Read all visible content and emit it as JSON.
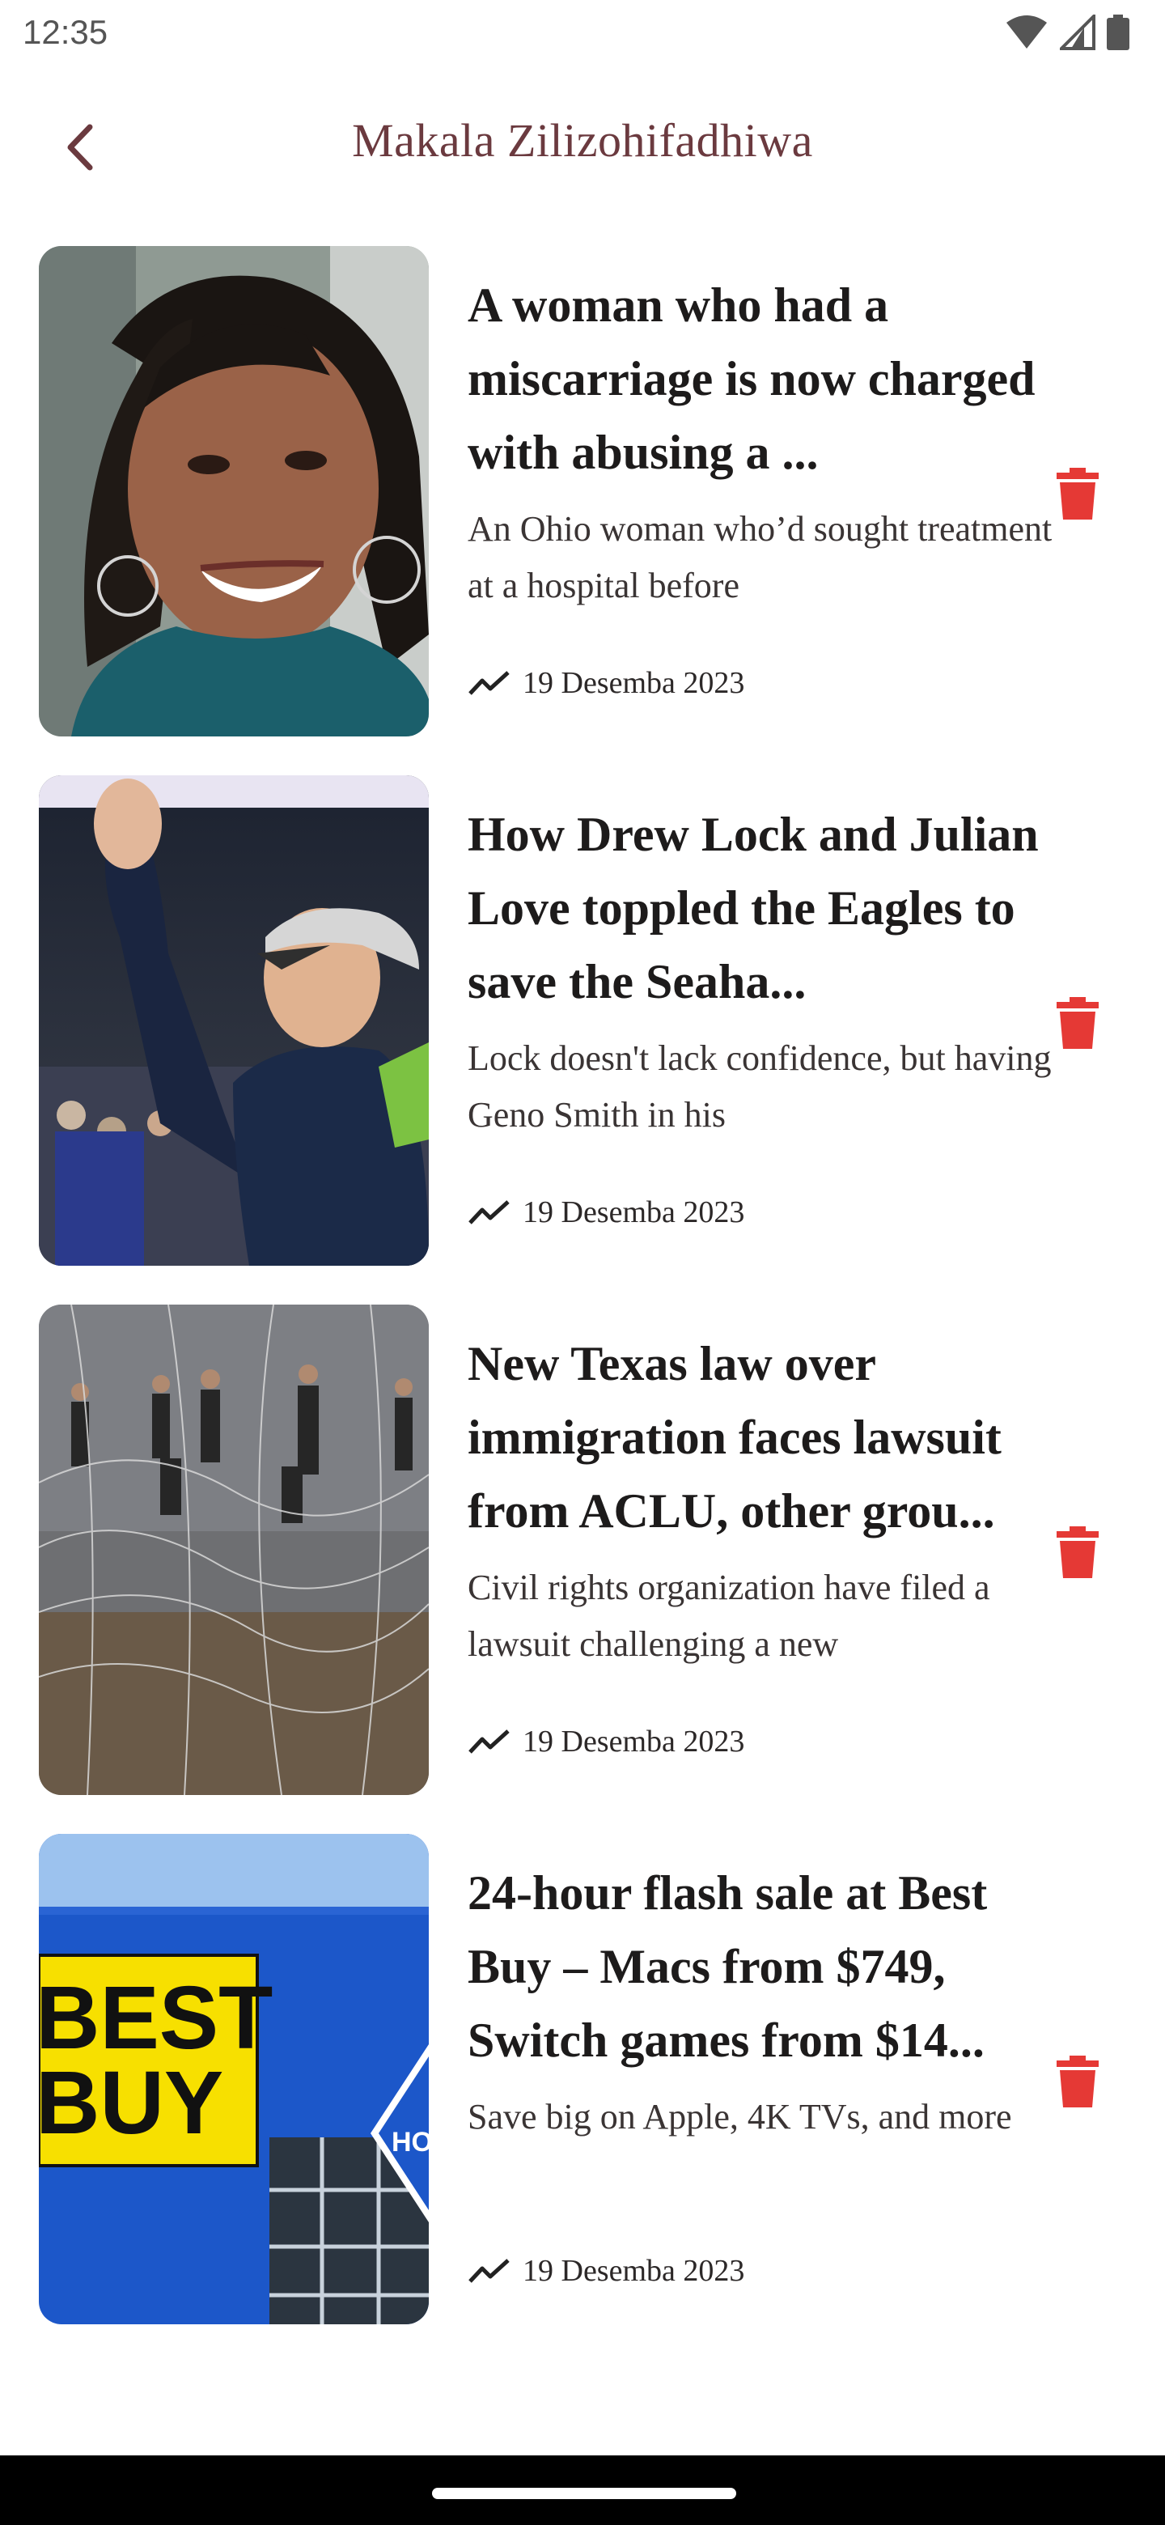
{
  "status": {
    "time": "12:35"
  },
  "header": {
    "title": "Makala Zilizohifadhiwa"
  },
  "articles": [
    {
      "headline": "A woman who had a miscarriage is now charged with abusing a ...",
      "summary": "An Ohio woman who’d sought treatment at a hospital before",
      "date": "19 Desemba 2023"
    },
    {
      "headline": "How Drew Lock and Julian Love toppled the Eagles to save the Seaha...",
      "summary": "Lock doesn't lack confidence, but having Geno Smith in his",
      "date": "19 Desemba 2023"
    },
    {
      "headline": "New Texas law over immigration faces lawsuit from ACLU, other grou...",
      "summary": "Civil rights organization have filed a lawsuit challenging a new",
      "date": "19 Desemba 2023"
    },
    {
      "headline": "24-hour flash sale at Best Buy – Macs from $749, Switch games from $14...",
      "summary": "Save big on Apple, 4K TVs, and more",
      "date": "19 Desemba 2023"
    }
  ],
  "thumb4": {
    "logo_line1": "BEST",
    "logo_line2": "BUY",
    "sign_text": "HO"
  },
  "colors": {
    "title": "#6b3a3f",
    "delete": "#e53935",
    "nav": "#000000"
  },
  "icons": {
    "back": "chevron-left-icon",
    "trend": "trending-up-icon",
    "delete": "trash-icon"
  }
}
